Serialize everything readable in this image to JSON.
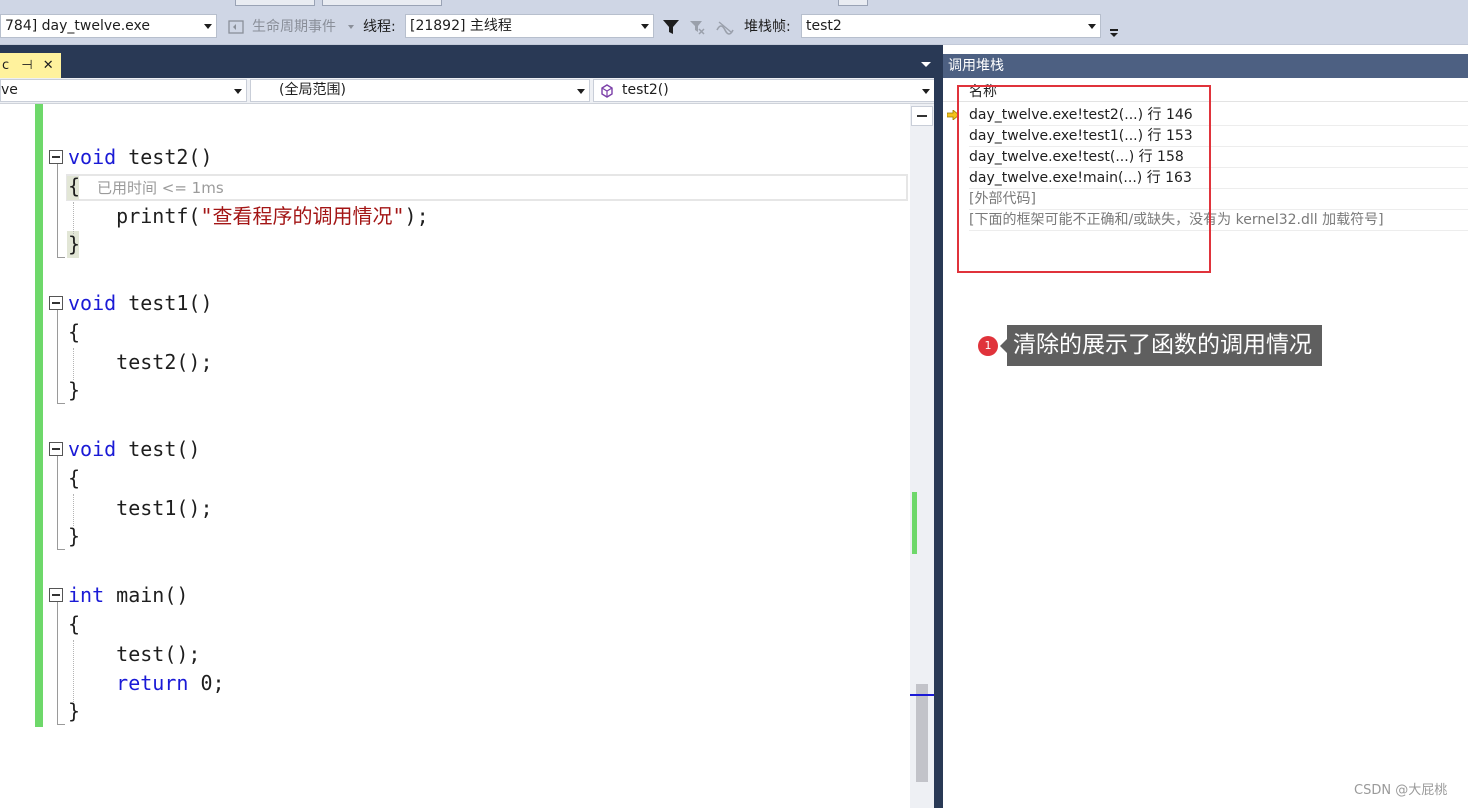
{
  "toolbar": {
    "process_value": "784] day_twelve.exe",
    "lifecycle_label": "生命周期事件",
    "thread_label": "线程:",
    "thread_value": "[21892] 主线程",
    "stackframe_label": "堆栈帧:",
    "stackframe_value": "test2"
  },
  "editor": {
    "tab_label": "c",
    "tab_pin": "⊣",
    "nav_left": "ve",
    "nav_scope": "(全局范围)",
    "nav_function": "test2()",
    "elapsed_hint": "已用时间 <= 1ms",
    "code": {
      "l1_kw": "void",
      "l1_rest": " test2()",
      "l2": "{",
      "l3_fn": "    printf(",
      "l3_str": "\"查看程序的调用情况\"",
      "l3_end": ");",
      "l4": "}",
      "l5_kw": "void",
      "l5_rest": " test1()",
      "l6": "{",
      "l7": "    test2();",
      "l8": "}",
      "l9_kw": "void",
      "l9_rest": " test()",
      "l10": "{",
      "l11": "    test1();",
      "l12": "}",
      "l13_kw": "int",
      "l13_rest": " main()",
      "l14": "{",
      "l15": "    test();",
      "l16_kw": "    return",
      "l16_rest": " 0;",
      "l17": "}"
    }
  },
  "call_stack": {
    "title": "调用堆栈",
    "column_name": "名称",
    "rows": [
      "day_twelve.exe!test2(...) 行 146",
      "day_twelve.exe!test1(...) 行 153",
      "day_twelve.exe!test(...) 行 158",
      "day_twelve.exe!main(...) 行 163",
      "[外部代码]",
      "[下面的框架可能不正确和/或缺失，没有为 kernel32.dll 加载符号]"
    ]
  },
  "annotation": {
    "number": "1",
    "text": "清除的展示了函数的调用情况"
  },
  "watermark": "CSDN @大屁桃",
  "colors": {
    "accent_highlight": "#e0333b",
    "change_bar": "#6ed86a",
    "keyword": "#1a1ad6",
    "string": "#a31515"
  }
}
